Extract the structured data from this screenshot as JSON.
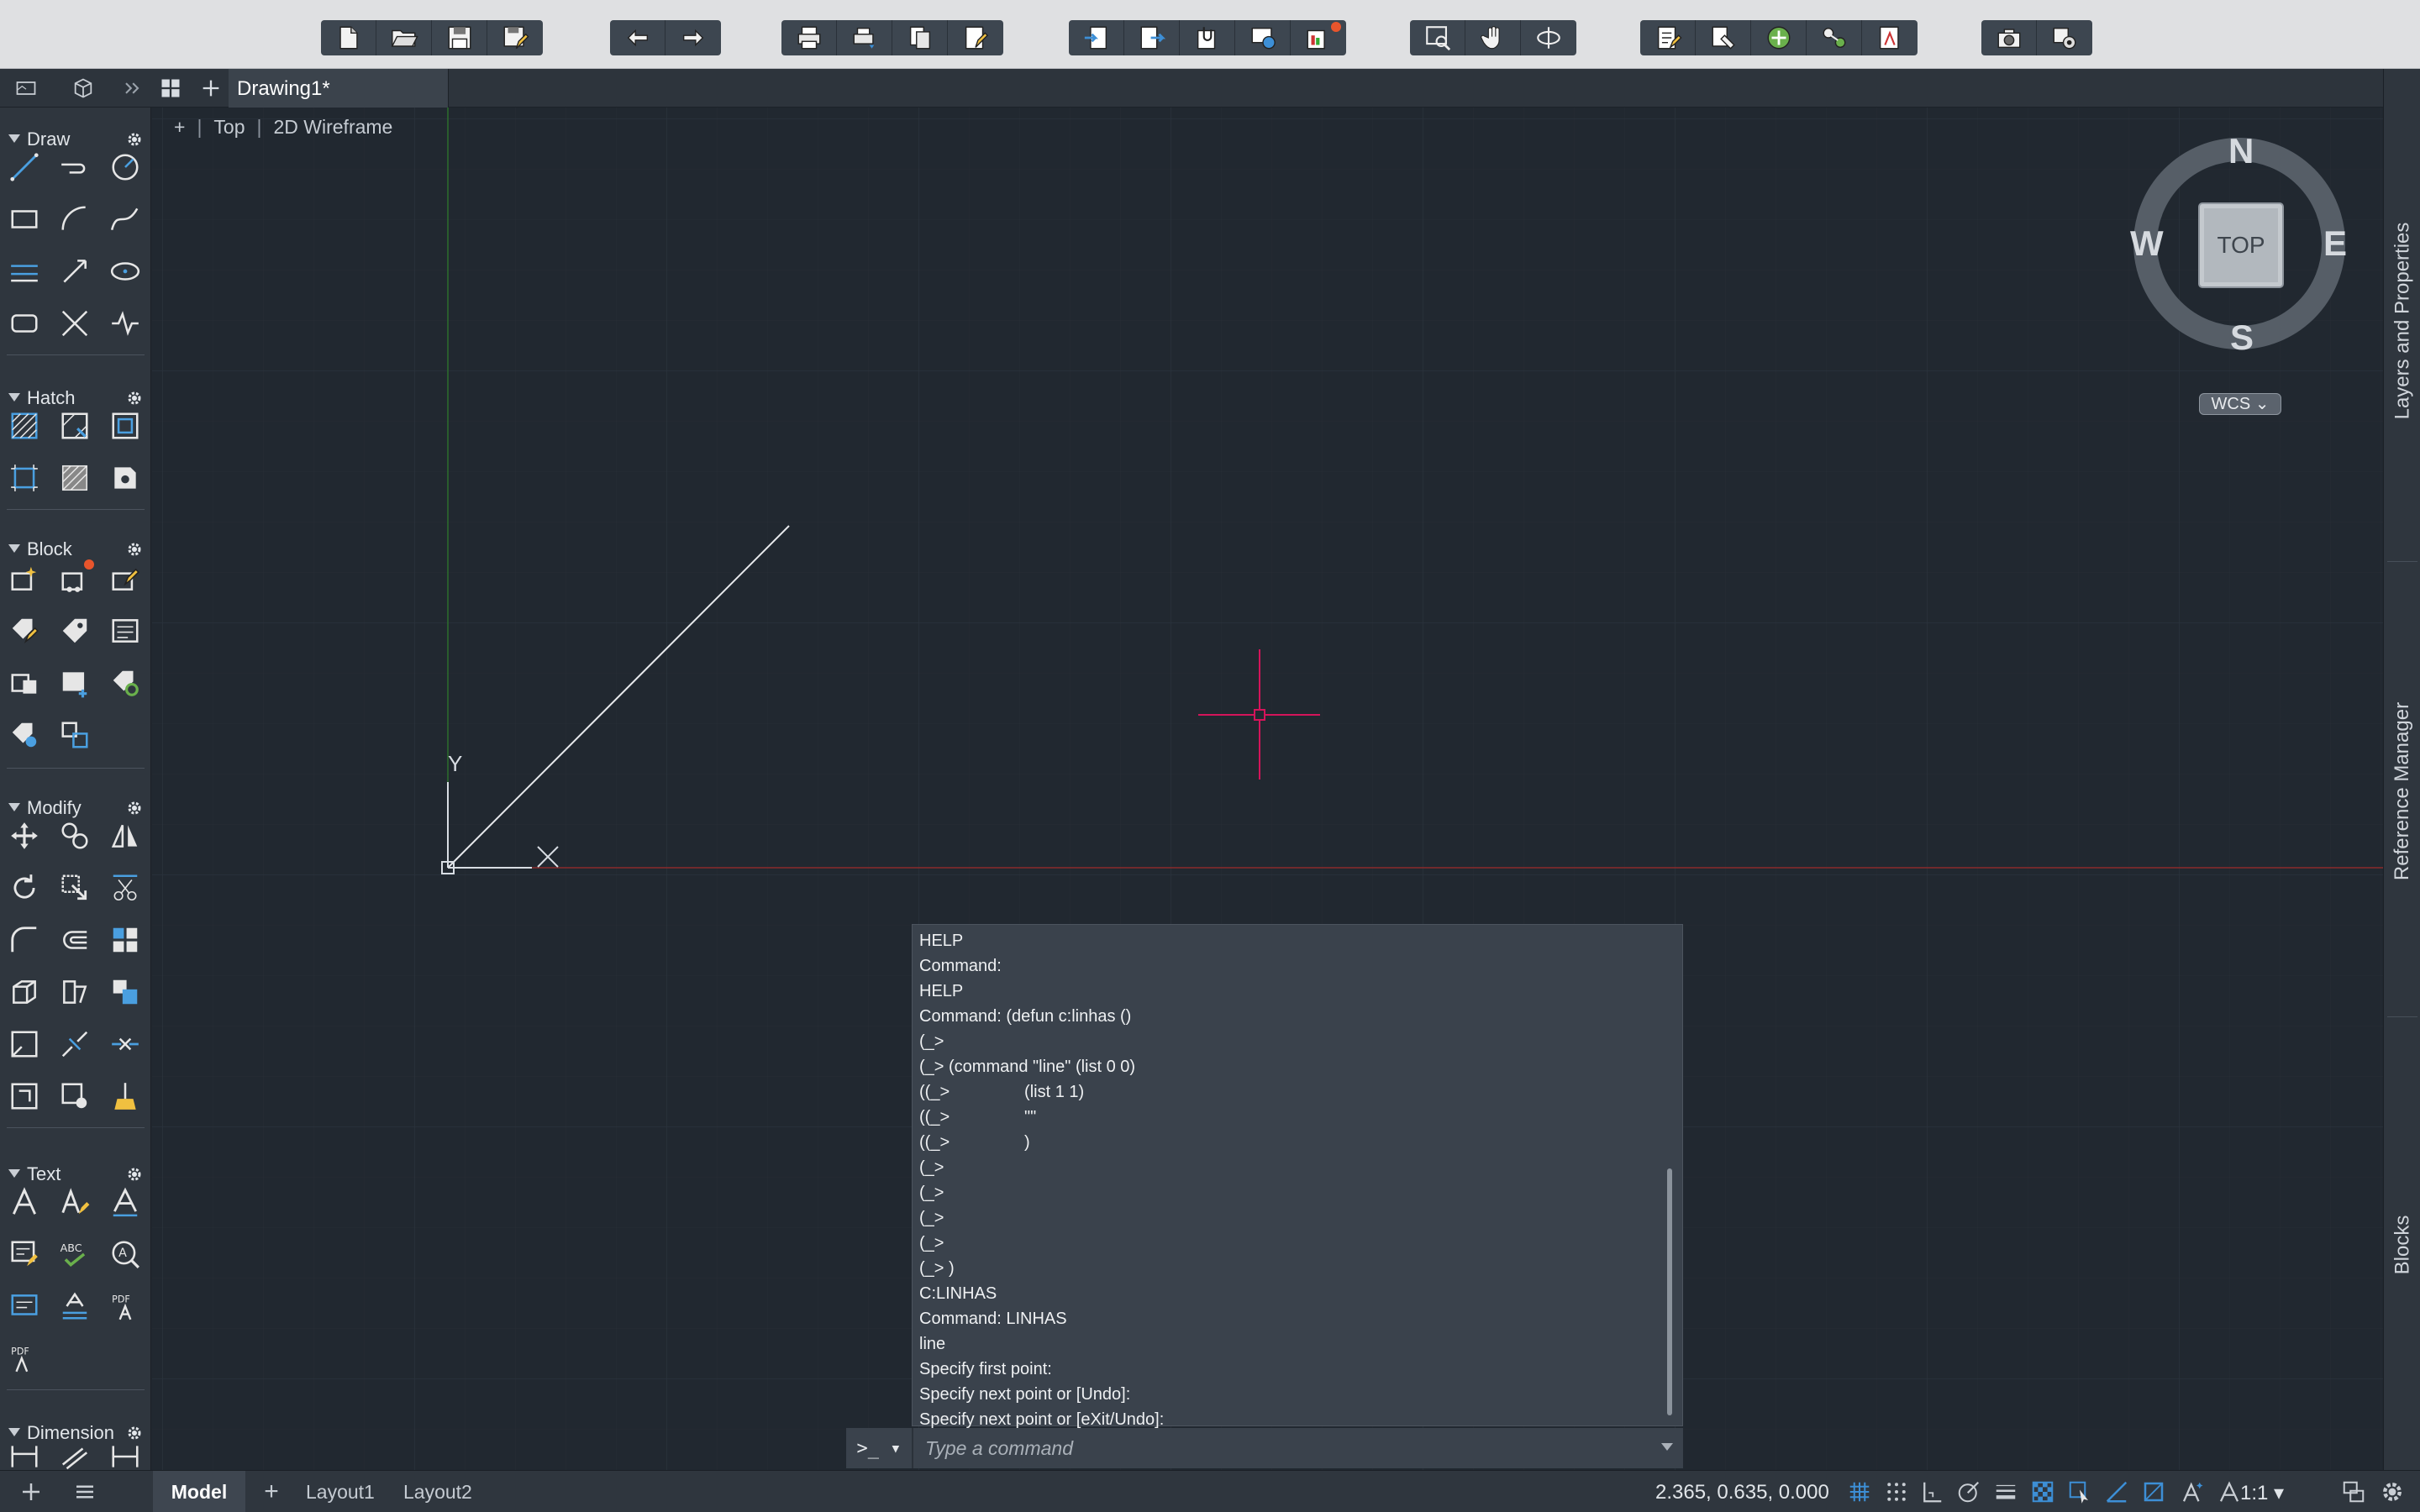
{
  "toolbar": {
    "groups": [
      [
        "new-icon",
        "open-icon",
        "save-icon",
        "save-as-icon"
      ],
      [
        "undo-icon",
        "redo-icon"
      ],
      [
        "plot-icon",
        "batch-plot-icon",
        "publish-icon",
        "page-setup-icon"
      ],
      [
        "import-icon",
        "export-icon",
        "attach-icon",
        "share-icon",
        "render-icon"
      ],
      [
        "zoom-window-icon",
        "pan-icon",
        "orbit-icon"
      ],
      [
        "properties-icon",
        "match-properties-icon",
        "layer-icon",
        "layer-state-icon",
        "pdf-import-icon"
      ],
      [
        "camera-icon",
        "view-manager-icon"
      ]
    ]
  },
  "tabs": {
    "document": "Drawing1*"
  },
  "palette": {
    "sections": [
      {
        "label": "Draw"
      },
      {
        "label": "Hatch"
      },
      {
        "label": "Block"
      },
      {
        "label": "Modify"
      },
      {
        "label": "Text"
      },
      {
        "label": "Dimension"
      }
    ]
  },
  "viewport": {
    "plus": "+",
    "view": "Top",
    "style": "2D Wireframe"
  },
  "viewcube": {
    "north": "N",
    "south": "S",
    "east": "E",
    "west": "W",
    "face": "TOP",
    "ucs": "WCS"
  },
  "axes": {
    "y": "Y"
  },
  "command": {
    "history": [
      "HELP",
      "Command:",
      "HELP",
      "Command: (defun c:linhas ()",
      "(_>",
      "(_> (command \"line\" (list 0 0)",
      "((_>                (list 1 1)",
      "((_>                \"\"",
      "((_>                )",
      "(_>",
      "(_>",
      "(_>",
      "(_>",
      "(_> )",
      "C:LINHAS",
      "Command: LINHAS",
      "line",
      "Specify first point:",
      "Specify next point or [Undo]:",
      "Specify next point or [eXit/Undo]:"
    ],
    "prompt_symbol": ">_ ▾",
    "placeholder": "Type a command"
  },
  "right_panel": {
    "items": [
      "Layers and Properties",
      "Reference Manager",
      "Blocks"
    ]
  },
  "status": {
    "layouts": [
      "Model",
      "Layout1",
      "Layout2"
    ],
    "add": "+",
    "coordinates": "2.365, 0.635, 0.000",
    "scale": "1:1 ▾"
  },
  "colors": {
    "background": "#212830",
    "crosshair": "#d4145a",
    "x_axis": "#8b2a2a",
    "y_axis": "#2c6e2c",
    "accent_blue": "#3d8fd6"
  }
}
